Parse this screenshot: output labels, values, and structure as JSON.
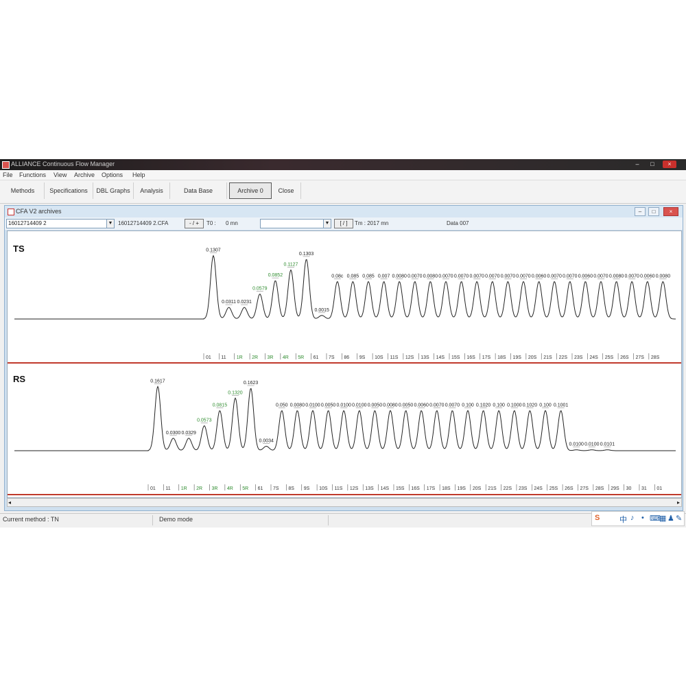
{
  "window": {
    "title": "ALLIANCE Continuous Flow Manager",
    "controls": {
      "minimize": "–",
      "maximize": "□",
      "close": "×"
    }
  },
  "menu": [
    "File",
    "Functions",
    "View",
    "Archive",
    "Options",
    "Help"
  ],
  "toolbar": [
    "Methods",
    "Specifications",
    "DBL Graphs",
    "Analysis",
    "Data Base",
    "Archive 0",
    "Close"
  ],
  "subwindow": {
    "title": "CFA V2 archives",
    "archive_combo": "16012714409 2",
    "file_label": "16012714409 2.CFA",
    "nav_button": "- / +",
    "to_label": "T0 :",
    "to_value": "0 mn",
    "second_combo": "",
    "fit_button": "[ / ]",
    "time_label": "Tm : 2017 mn",
    "data_label": "Data 007"
  },
  "channels": [
    {
      "name": "TS",
      "peak_labels": [
        "0.1307",
        "0.0311",
        "0.0231",
        "0.0579",
        "0.0852",
        "0.1127",
        "0.1303",
        "0.0015",
        "0.08c",
        "0.085",
        "0.085",
        "0.007",
        "0.0080",
        "0.0070",
        "0.0080",
        "0.0070",
        "0.0070",
        "0.0070",
        "0.0070",
        "0.0070",
        "0.0070",
        "0.0060",
        "0.0070",
        "0.0070",
        "0.0060",
        "0.0070",
        "0.0080",
        "0.0070",
        "0.0060",
        "0.0080"
      ],
      "peak_heights": [
        0.71,
        0.13,
        0.13,
        0.28,
        0.43,
        0.55,
        0.67,
        0.04,
        0.42,
        0.42,
        0.42,
        0.42,
        0.42,
        0.42,
        0.42,
        0.42,
        0.42,
        0.42,
        0.42,
        0.42,
        0.42,
        0.42,
        0.42,
        0.42,
        0.42,
        0.42,
        0.42,
        0.42,
        0.42,
        0.42
      ],
      "axis_ticks": [
        "01",
        "11",
        "1R",
        "2R",
        "3R",
        "4R",
        "5R",
        "61",
        "7S",
        "86",
        "9S",
        "10S",
        "11S",
        "12S",
        "13S",
        "14S",
        "15S",
        "16S",
        "17S",
        "18S",
        "19S",
        "20S",
        "21S",
        "22S",
        "23S",
        "24S",
        "25S",
        "26S",
        "27S",
        "28S"
      ]
    },
    {
      "name": "RS",
      "peak_labels": [
        "0.1617",
        "0.0300",
        "0.0329",
        "0.0573",
        "0.0815",
        "0.1320",
        "0.1623",
        "0.0034",
        "0.050",
        "0.0080",
        "0.0100",
        "0.0050",
        "0.0100",
        "0.0100",
        "0.0050",
        "0.0080",
        "0.0050",
        "0.0060",
        "0.0070",
        "0.0070",
        "0.100",
        "0.1020",
        "0.100",
        "0.1000",
        "0.1020",
        "0.100",
        "0.1001",
        "0.0100",
        "0.0100",
        "0.0101"
      ],
      "peak_heights": [
        0.72,
        0.14,
        0.14,
        0.28,
        0.45,
        0.59,
        0.7,
        0.05,
        0.45,
        0.45,
        0.45,
        0.45,
        0.45,
        0.45,
        0.45,
        0.45,
        0.45,
        0.45,
        0.45,
        0.45,
        0.45,
        0.45,
        0.45,
        0.45,
        0.45,
        0.45,
        0.45,
        0.01,
        0.01,
        0.01
      ],
      "axis_ticks": [
        "01",
        "11",
        "1R",
        "2R",
        "3R",
        "4R",
        "5R",
        "61",
        "7S",
        "8S",
        "9S",
        "10S",
        "11S",
        "12S",
        "13S",
        "14S",
        "15S",
        "16S",
        "17S",
        "18S",
        "19S",
        "20S",
        "21S",
        "22S",
        "23S",
        "24S",
        "25S",
        "26S",
        "27S",
        "28S",
        "29S",
        "30",
        "31",
        "01"
      ]
    }
  ],
  "colors": {
    "separator": "#c0392b",
    "trace": "#222222",
    "green_tick": "#2e8b2e"
  },
  "status": {
    "method": "Current method : TN",
    "mode": "Demo mode"
  },
  "ime": [
    "S",
    "中",
    "♪",
    "•",
    "⌨",
    "▦",
    "♟",
    "✎"
  ]
}
